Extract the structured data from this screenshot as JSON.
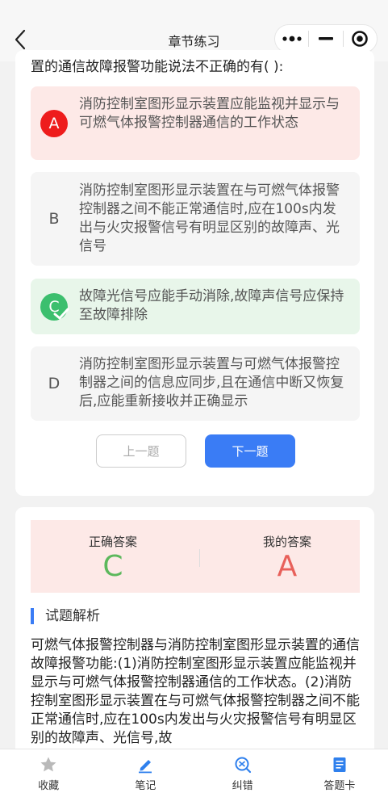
{
  "header": {
    "title": "章节练习",
    "back_icon": "chevron-left-icon",
    "capsule": [
      "more-icon",
      "minimize-icon",
      "close-target-icon"
    ]
  },
  "question": {
    "stem": "置的通信故障报警功能说法不正确的有( ):",
    "options": [
      {
        "letter": "A",
        "text": "消防控制室图形显示装置应能监视并显示与可燃气体报警控制器通信的工作状态",
        "state": "selected-wrong"
      },
      {
        "letter": "B",
        "text": "消防控制室图形显示装置在与可燃气体报警控制器之间不能正常通信时,应在100s内发出与火灾报警信号有明显区别的故障声、光信号",
        "state": "normal"
      },
      {
        "letter": "C",
        "text": "故障光信号应能手动消除,故障声信号应保持至故障排除",
        "state": "correct"
      },
      {
        "letter": "D",
        "text": "消防控制室图形显示装置与可燃气体报警控制器之间的信息应同步,且在通信中断又恢复后,应能重新接收并正确显示",
        "state": "normal"
      }
    ],
    "prev_label": "上一题",
    "next_label": "下一题"
  },
  "answer": {
    "correct_label": "正确答案",
    "correct_value": "C",
    "mine_label": "我的答案",
    "mine_value": "A",
    "section_title": "试题解析",
    "analysis_text": "可燃气体报警控制器与消防控制室图形显示装置的通信故障报警功能:(1)消防控制室图形显示装置应能监视并显示与可燃气体报警控制器通信的工作状态。(2)消防控制室图形显示装置在与可燃气体报警控制器之间不能正常通信时,应在100s内发出与火灾报警信号有明显区别的故障声、光信号,故"
  },
  "bottom_tabs": [
    {
      "label": "收藏",
      "icon": "star-icon"
    },
    {
      "label": "笔记",
      "icon": "pencil-icon"
    },
    {
      "label": "纠错",
      "icon": "correction-icon"
    },
    {
      "label": "答题卡",
      "icon": "answer-card-icon"
    }
  ],
  "colors": {
    "primary": "#3a7cf5",
    "wrong_bg": "#fde9e7",
    "right_bg": "#e8f6ea",
    "correct_text": "#5cb85c",
    "mine_text": "#e8605a"
  }
}
